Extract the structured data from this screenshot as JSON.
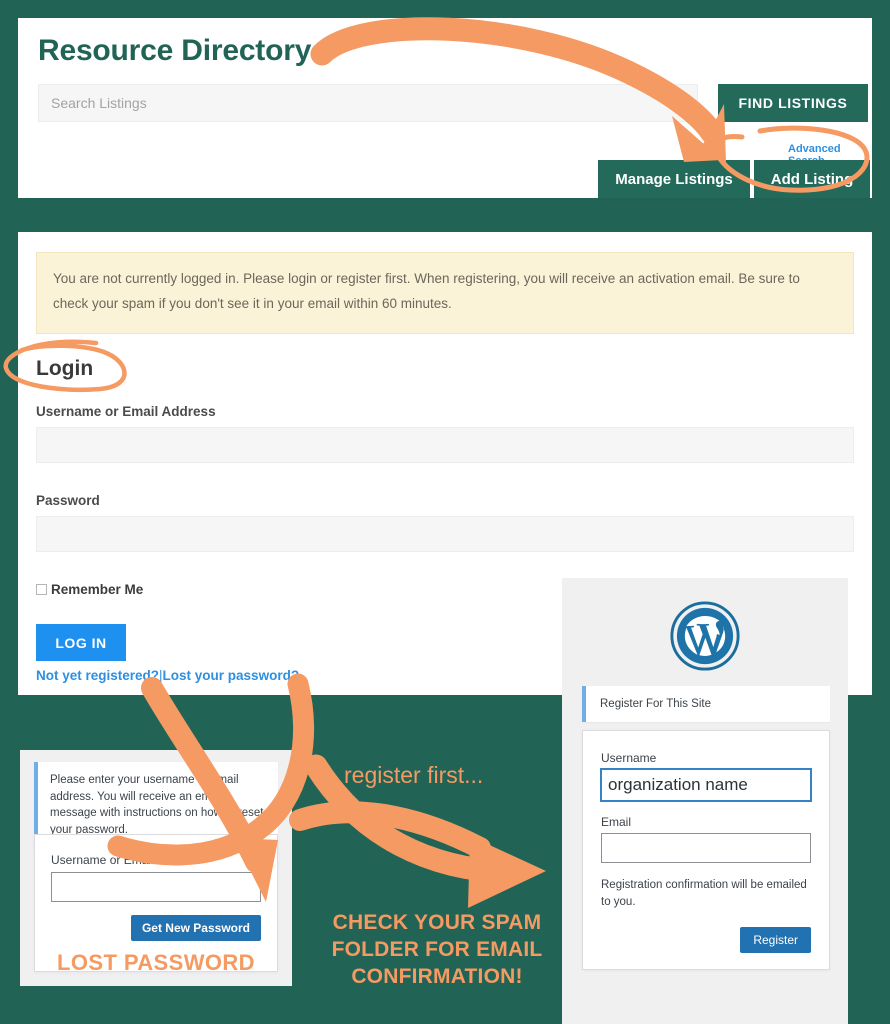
{
  "page": {
    "background_color": "#216456",
    "annotation_color": "#F49A62"
  },
  "header": {
    "title": "Resource Directory",
    "search": {
      "placeholder": "Search Listings",
      "value": ""
    },
    "find_listings_label": "FIND LISTINGS",
    "advanced_search_label": "Advanced Search",
    "manage_listings_label": "Manage Listings",
    "add_listing_label": "Add Listing",
    "button_color": "#246A5B"
  },
  "main": {
    "notice": "You are not currently logged in. Please login or register first. When registering, you will receive an activation email. Be sure to check your spam if you don't see it in your email within 60 minutes.",
    "login_heading": "Login",
    "username_label": "Username or Email Address",
    "username_value": "",
    "password_label": "Password",
    "password_value": "",
    "remember_me_label": "Remember Me",
    "remember_me_checked": false,
    "log_in_label": "LOG IN",
    "not_registered_label": "Not yet registered?",
    "links_separator": "|",
    "lost_password_label": "Lost your password?",
    "link_color": "#2E8FE0",
    "login_button_color": "#1E90EF"
  },
  "wordpress_register": {
    "logo": "wordpress-logo",
    "message": "Register For This Site",
    "username_label": "Username",
    "username_value": "organization name",
    "email_label": "Email",
    "email_value": "",
    "note": "Registration confirmation will be emailed to you.",
    "register_button_label": "Register",
    "button_color": "#2271B1"
  },
  "lost_password": {
    "message": "Please enter your username or email address. You will receive an email message with instructions on how to reset your password.",
    "username_label": "Username or Email Address",
    "username_value": "",
    "submit_label": "Get New Password",
    "caption": "LOST PASSWORD"
  },
  "annotations": {
    "register_first": "register first...",
    "check_spam": "CHECK YOUR SPAM FOLDER FOR EMAIL CONFIRMATION!",
    "arrow_title_to_add_listing": "curved-arrow-icon",
    "circle_add_listing": "ellipse-highlight-icon",
    "circle_login": "ellipse-highlight-icon",
    "arrow_to_lost_password": "curved-arrow-icon",
    "arrow_to_register": "curved-arrow-icon"
  }
}
